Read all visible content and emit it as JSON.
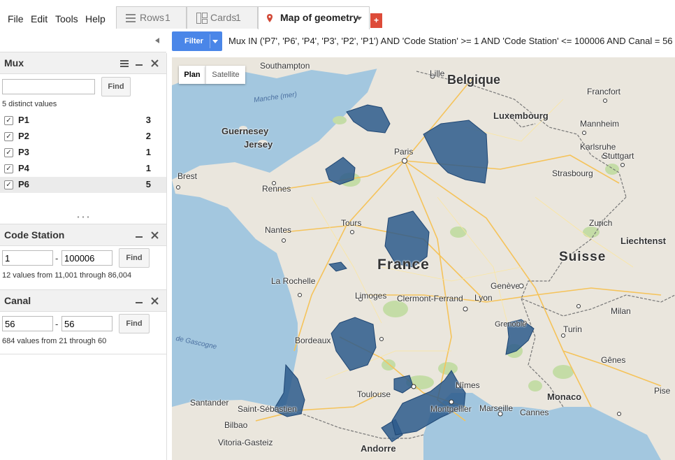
{
  "menu": {
    "file": "File",
    "edit": "Edit",
    "tools": "Tools",
    "help": "Help"
  },
  "tabs": {
    "rows": "Rows",
    "rows_count": "1",
    "cards": "Cards",
    "cards_count": "1",
    "map": "Map of geometry",
    "add": "+"
  },
  "filter": {
    "button": "Filter",
    "query": "Mux IN ('P7', 'P6', 'P4', 'P3', 'P2', 'P1') AND 'Code Station' >= 1 AND 'Code Station' <= 100006 AND Canal = 56"
  },
  "mux": {
    "title": "Mux",
    "search_value": "",
    "find": "Find",
    "distinct": "5 distinct values",
    "items": [
      {
        "label": "P1",
        "count": "3",
        "checked": "✓"
      },
      {
        "label": "P2",
        "count": "2",
        "checked": "✓"
      },
      {
        "label": "P3",
        "count": "1",
        "checked": "✓"
      },
      {
        "label": "P4",
        "count": "1",
        "checked": "✓"
      },
      {
        "label": "P6",
        "count": "5",
        "checked": "✓"
      }
    ]
  },
  "code_station": {
    "title": "Code Station",
    "min": "1",
    "sep": "-",
    "max": "100006",
    "find": "Find",
    "summary": "12 values from 11,001 through 86,004"
  },
  "canal": {
    "title": "Canal",
    "min": "56",
    "sep": "-",
    "max": "56",
    "find": "Find",
    "summary": "684 values from 21 through 60"
  },
  "map": {
    "plan": "Plan",
    "satellite": "Satellite",
    "labels": {
      "southampton": "Southampton",
      "lille": "Lille",
      "belgique": "Belgique",
      "frankfort": "Francfort",
      "manche": "Manche (mer)",
      "luxembourg": "Luxembourg",
      "guernsey": "Guernesey",
      "jersey": "Jersey",
      "mannheim": "Mannheim",
      "karlsruhe": "Karlsruhe",
      "stuttgart": "Stuttgart",
      "paris": "Paris",
      "brest": "Brest",
      "strasbourg": "Strasbourg",
      "rennes": "Rennes",
      "nantes": "Nantes",
      "tours": "Tours",
      "zurich": "Zurich",
      "liechtenstein": "Liechtenst",
      "france": "France",
      "suisse": "Suisse",
      "la_rochelle": "La Rochelle",
      "geneve": "Genève",
      "limoges": "Limoges",
      "clermont": "Clermont-Ferrand",
      "lyon": "Lyon",
      "milan": "Milan",
      "grenoble": "Grenoble",
      "turin": "Turin",
      "bordeaux": "Bordeaux",
      "gascogne": "de Gascogne",
      "genes": "Gênes",
      "nimes": "Nîmes",
      "toulouse": "Toulouse",
      "montpellier": "Montpellier",
      "marseille": "Marseille",
      "monaco": "Monaco",
      "pise": "Pise",
      "santander": "Santander",
      "saint_sebastien": "Saint-Sébastien",
      "cannes": "Cannes",
      "bilbao": "Bilbao",
      "andorre": "Andorre",
      "vitoria": "Vitoria-Gasteiz"
    }
  },
  "colors": {
    "accent": "#4a86e8",
    "polygon": "#2d5a8c",
    "tab_add": "#dd4b39"
  }
}
